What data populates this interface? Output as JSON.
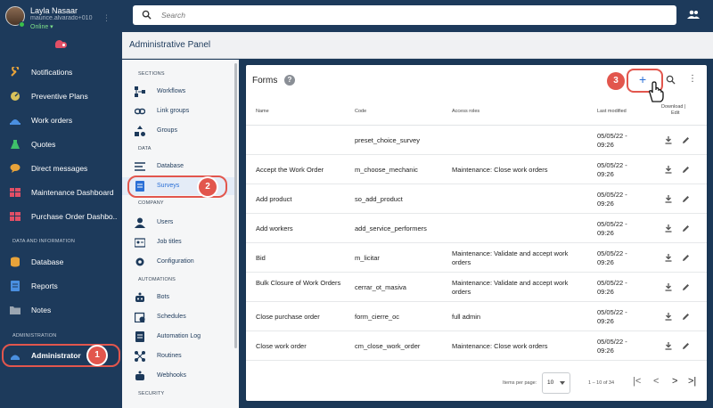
{
  "user": {
    "name": "Layla Nasaar",
    "email": "maurice.alvarado+010...",
    "status": "Online ▾"
  },
  "sidebar": {
    "items": [
      {
        "label": "Notifications",
        "icon": "wrench-icon",
        "color": "#e8a33a"
      },
      {
        "label": "Preventive Plans",
        "icon": "gauge-icon",
        "color": "#d8c25a"
      },
      {
        "label": "Work orders",
        "icon": "helmet-icon",
        "color": "#4a8fe0"
      },
      {
        "label": "Quotes",
        "icon": "flask-icon",
        "color": "#3fbf6a"
      },
      {
        "label": "Direct messages",
        "icon": "chat-icon",
        "color": "#e8a33a"
      },
      {
        "label": "Maintenance Dashboard",
        "icon": "dashboard-icon",
        "color": "#e24f66"
      },
      {
        "label": "Purchase Order Dashbo...",
        "icon": "dashboard-icon",
        "color": "#e24f66"
      }
    ],
    "section_data": "DATA AND INFORMATION",
    "data_items": [
      {
        "label": "Database",
        "icon": "database-icon",
        "color": "#e8a33a"
      },
      {
        "label": "Reports",
        "icon": "report-icon",
        "color": "#4a8fe0"
      },
      {
        "label": "Notes",
        "icon": "folder-icon",
        "color": "#9aa5b1"
      }
    ],
    "section_admin": "ADMINISTRATION",
    "admin_item": {
      "label": "Administrator",
      "icon": "admin-icon",
      "color": "#4a8fe0"
    }
  },
  "search": {
    "placeholder": "Search"
  },
  "panel": {
    "title": "Administrative Panel"
  },
  "subnav": {
    "sections": {
      "sections": "SECTIONS",
      "data": "DATA",
      "company": "COMPANY",
      "automations": "AUTOMATIONS",
      "security": "SECURITY"
    },
    "sections_items": [
      "Workflows",
      "Link groups",
      "Groups"
    ],
    "data_items": [
      "Database",
      "Surveys"
    ],
    "company_items": [
      "Users",
      "Job titles",
      "Configuration"
    ],
    "automation_items": [
      "Bots",
      "Schedules",
      "Automation Log",
      "Routines",
      "Webhooks"
    ]
  },
  "forms": {
    "title": "Forms",
    "help": "?",
    "add": "+",
    "more": "⋮",
    "columns": {
      "name": "Name",
      "code": "Code",
      "roles": "Access roles",
      "modified": "Last modified",
      "actions_1": "Download |",
      "actions_2": "Edit"
    },
    "rows": [
      {
        "name": "",
        "code": "preset_choice_survey",
        "roles": "",
        "date": "05/05/22 -",
        "time": "09:26"
      },
      {
        "name": "Accept the Work Order",
        "code": "m_choose_mechanic",
        "roles": "Maintenance: Close work orders",
        "date": "05/05/22 -",
        "time": "09:26"
      },
      {
        "name": "Add product",
        "code": "so_add_product",
        "roles": "",
        "date": "05/05/22 -",
        "time": "09:26"
      },
      {
        "name": "Add workers",
        "code": "add_service_performers",
        "roles": "",
        "date": "05/05/22 -",
        "time": "09:26"
      },
      {
        "name": "Bid",
        "code": "m_licitar",
        "roles": "Maintenance: Validate and accept work orders",
        "date": "05/05/22 -",
        "time": "09:26"
      },
      {
        "name": "Bulk Closure of Work Orders",
        "code": "cerrar_ot_masiva",
        "roles": "Maintenance: Validate and accept work orders",
        "date": "05/05/22 -",
        "time": "09:26"
      },
      {
        "name": "Close purchase order",
        "code": "form_cierre_oc",
        "roles": "full admin",
        "date": "05/05/22 -",
        "time": "09:26"
      },
      {
        "name": "Close work order",
        "code": "cm_close_work_order",
        "roles": "Maintenance: Close work orders",
        "date": "05/05/22 -",
        "time": "09:26"
      }
    ],
    "footer": {
      "per_page_label": "Items per page:",
      "per_page": "10",
      "range": "1 – 10 of 34",
      "first": "|<",
      "prev": "<",
      "next": ">",
      "last": ">|"
    }
  },
  "callouts": {
    "one": "1",
    "two": "2",
    "three": "3"
  },
  "colors": {
    "accent": "#2a6fd6",
    "callout": "#e2564d",
    "sidebar": "#1d3a5b"
  }
}
